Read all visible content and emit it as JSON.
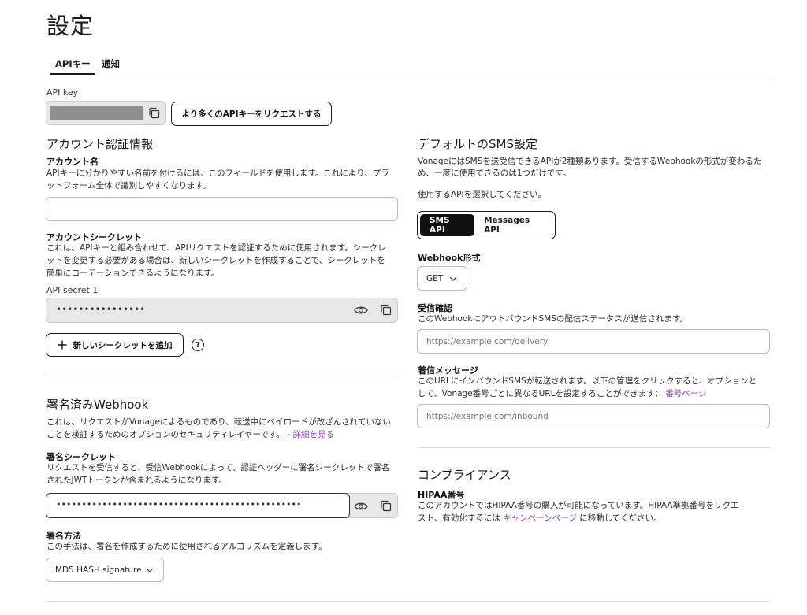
{
  "page": {
    "title": "設定"
  },
  "tabs": [
    {
      "label": "APIキー",
      "active": true
    },
    {
      "label": "通知",
      "active": false
    }
  ],
  "api_key": {
    "label": "API key",
    "request_button": "より多くのAPIキーをリクエストする"
  },
  "credentials": {
    "heading": "アカウント認証情報",
    "account_name_label": "アカウント名",
    "account_name_desc1": "APIキーに分かりやすい名前を付けるには、このフィールドを使用します。これにより、プラ",
    "account_name_desc2": "ットフォーム全体で識別しやすくなります。",
    "account_name_value": "",
    "secret_label": "アカウントシークレット",
    "secret_desc1": "これは、APIキーと組み合わせて、APIリクエストを認証するために使用されます。シークレ",
    "secret_desc2": "ットを変更する必要がある場合は、新しいシークレットを作成することで、シークレットを",
    "secret_desc3": "簡単にローテーションできるようになります。",
    "api_secret_label": "API secret 1",
    "api_secret_value": "••••••••••••••••",
    "add_secret_button": "新しいシークレットを追加",
    "help_glyph": "?"
  },
  "webhook": {
    "heading": "署名済みWebhook",
    "desc1": "これは、リクエストがVonageによるものであり、転送中にペイロードが改ざんされていない",
    "desc2": "ことを検証するためのオプションのセキュリティレイヤーです。 - ",
    "learn_more": "詳細を見る",
    "sig_secret_label": "署名シークレット",
    "sig_secret_desc1": "リクエストを受信すると、受信Webhookによって、認証ヘッダーに署名シークレットで署名",
    "sig_secret_desc2": "されたJWTトークンが含まれるようになります。",
    "sig_secret_value": "••••••••••••••••••••••••••••••••••••••••••••••••",
    "method_label": "署名方法",
    "method_desc": "この手法は、署名を作成するために使用されるアルゴリズムを定義します。",
    "method_value": "MD5 HASH signature"
  },
  "sms": {
    "heading": "デフォルトのSMS設定",
    "desc1": "VonageにはSMSを送受信できるAPIが2種類あります。受信するWebhookの形式が変わるた",
    "desc2": "め、一度に使用できるのは1つだけです。",
    "select_prompt": "使用するAPIを選択してください。",
    "options": [
      {
        "label": "SMS API",
        "active": true
      },
      {
        "label": "Messages API",
        "active": false
      }
    ],
    "webhook_format_label": "Webhook形式",
    "webhook_format_value": "GET",
    "delivery_label": "受信確認",
    "delivery_desc": "このWebhookにアウトバウンドSMSの配信ステータスが送信されます。",
    "delivery_placeholder": "https://example.com/delivery",
    "inbound_label": "着信メッセージ",
    "inbound_desc1": "このURLにインバウンドSMSが転送されます。以下の管理をクリックすると、オプションと",
    "inbound_desc2": "して、Vonage番号ごとに異なるURLを設定することができます：",
    "numbers_link": "番号ページ",
    "inbound_placeholder": "https://example.com/inbound"
  },
  "compliance": {
    "heading": "コンプライアンス",
    "hipaa_label": "HIPAA番号",
    "desc1": "このアカウントではHIPAA番号の購入が可能になっています。HIPAA準拠番号をリクエ",
    "desc2_pre": "スト、有効化するには ",
    "campaign_link": "キャンペーンページ",
    "desc2_post": " に移動してください。"
  }
}
